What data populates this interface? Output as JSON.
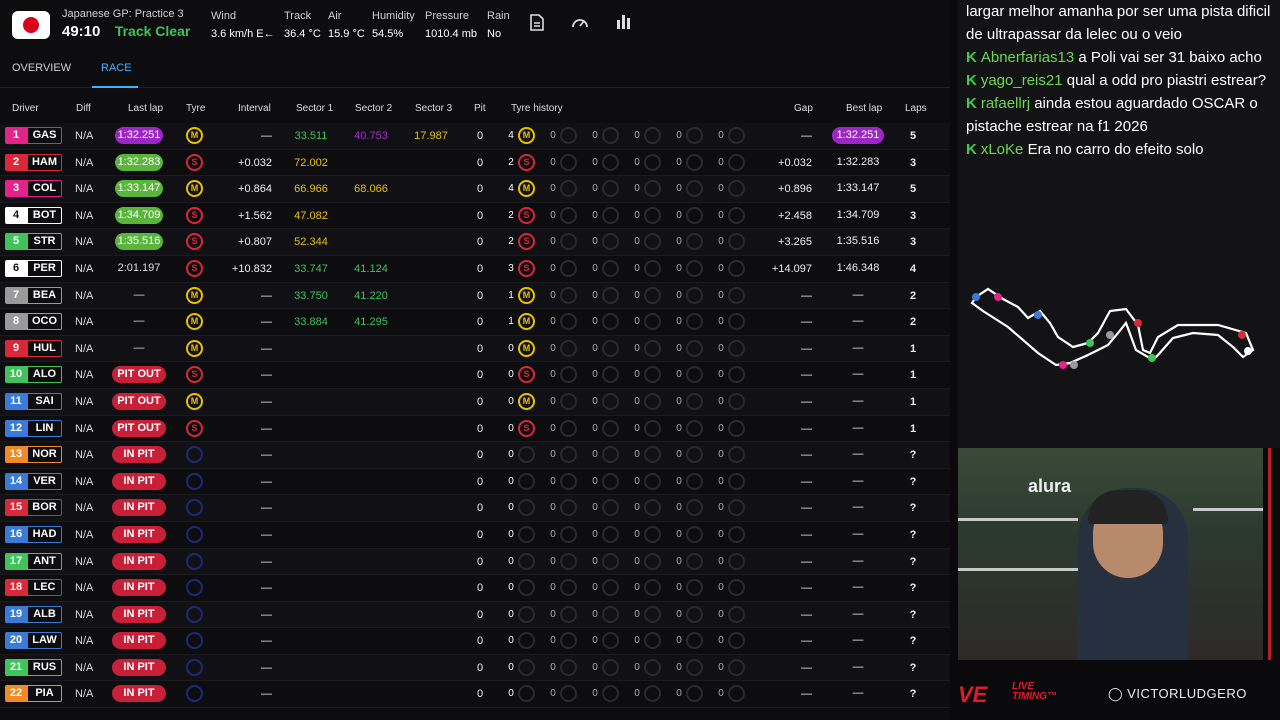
{
  "header": {
    "session_name": "Japanese GP: Practice 3",
    "clock": "49:10",
    "track_status": "Track Clear",
    "weather": [
      {
        "label": "Wind",
        "value": "3.6 km/h E←"
      },
      {
        "label": "Track",
        "value": "36.4 °C"
      },
      {
        "label": "Air",
        "value": "15.9 °C"
      },
      {
        "label": "Humidity",
        "value": "54.5%"
      },
      {
        "label": "Pressure",
        "value": "1010.4 mb"
      },
      {
        "label": "Rain",
        "value": "No"
      }
    ],
    "icons": [
      "document-icon",
      "speedometer-icon",
      "bar-chart-icon"
    ]
  },
  "tabs": [
    {
      "label": "OVERVIEW",
      "active": false
    },
    {
      "label": "RACE",
      "active": true
    }
  ],
  "columns": [
    "Driver",
    "Diff",
    "Last lap",
    "Tyre",
    "Interval",
    "Sector 1",
    "Sector 2",
    "Sector 3",
    "Pit",
    "Tyre history",
    "Gap",
    "Best lap",
    "Laps"
  ],
  "rows": [
    {
      "pos": "1",
      "code": "GAS",
      "team": "#e2238a",
      "diff": "N/A",
      "last": "1:32.251",
      "last_style": "purple",
      "tyre": "M",
      "interval": "—",
      "s1": "33.511",
      "s1c": "g",
      "s2": "40.753",
      "s2c": "p",
      "s3": "17.987",
      "s3c": "y",
      "pit": "0",
      "hist_n": "4",
      "hist_t": "M",
      "gap": "—",
      "best": "1:32.251",
      "best_style": "purple",
      "laps": "5"
    },
    {
      "pos": "2",
      "code": "HAM",
      "team": "#d8283a",
      "diff": "N/A",
      "last": "1:32.283",
      "last_style": "best",
      "tyre": "S",
      "interval": "+0.032",
      "s1": "72.002",
      "s1c": "y",
      "s2": "",
      "s2c": "",
      "s3": "",
      "s3c": "",
      "pit": "0",
      "hist_n": "2",
      "hist_t": "S",
      "gap": "+0.032",
      "best": "1:32.283",
      "best_style": "",
      "laps": "3"
    },
    {
      "pos": "3",
      "code": "COL",
      "team": "#e2238a",
      "diff": "N/A",
      "last": "1:33.147",
      "last_style": "best",
      "tyre": "M",
      "interval": "+0.864",
      "s1": "66.966",
      "s1c": "y",
      "s2": "68.066",
      "s2c": "y",
      "s3": "",
      "s3c": "",
      "pit": "0",
      "hist_n": "4",
      "hist_t": "M",
      "gap": "+0.896",
      "best": "1:33.147",
      "best_style": "",
      "laps": "5"
    },
    {
      "pos": "4",
      "code": "BOT",
      "team": "#ffffff",
      "diff": "N/A",
      "last": "1:34.709",
      "last_style": "best",
      "tyre": "S",
      "interval": "+1.562",
      "s1": "47.082",
      "s1c": "y",
      "s2": "",
      "s2c": "",
      "s3": "",
      "s3c": "",
      "pit": "0",
      "hist_n": "2",
      "hist_t": "S",
      "gap": "+2.458",
      "best": "1:34.709",
      "best_style": "",
      "laps": "3"
    },
    {
      "pos": "5",
      "code": "STR",
      "team": "#3fc35a",
      "diff": "N/A",
      "last": "1:35.516",
      "last_style": "best",
      "tyre": "S",
      "interval": "+0.807",
      "s1": "52.344",
      "s1c": "y",
      "s2": "",
      "s2c": "",
      "s3": "",
      "s3c": "",
      "pit": "0",
      "hist_n": "2",
      "hist_t": "S",
      "gap": "+3.265",
      "best": "1:35.516",
      "best_style": "",
      "laps": "3"
    },
    {
      "pos": "6",
      "code": "PER",
      "team": "#ffffff",
      "diff": "N/A",
      "last": "2:01.197",
      "last_style": "plain",
      "tyre": "S",
      "interval": "+10.832",
      "s1": "33.747",
      "s1c": "g",
      "s2": "41.124",
      "s2c": "g",
      "s3": "",
      "s3c": "",
      "pit": "0",
      "hist_n": "3",
      "hist_t": "S",
      "gap": "+14.097",
      "best": "1:46.348",
      "best_style": "",
      "laps": "4"
    },
    {
      "pos": "7",
      "code": "BEA",
      "team": "#9a9a9a",
      "diff": "N/A",
      "last": "—",
      "last_style": "plain",
      "tyre": "M",
      "interval": "—",
      "s1": "33.750",
      "s1c": "g",
      "s2": "41.220",
      "s2c": "g",
      "s3": "",
      "s3c": "",
      "pit": "0",
      "hist_n": "1",
      "hist_t": "M",
      "gap": "—",
      "best": "—",
      "best_style": "",
      "laps": "2"
    },
    {
      "pos": "8",
      "code": "OCO",
      "team": "#9a9a9a",
      "diff": "N/A",
      "last": "—",
      "last_style": "plain",
      "tyre": "M",
      "interval": "—",
      "s1": "33.884",
      "s1c": "g",
      "s2": "41.295",
      "s2c": "g",
      "s3": "",
      "s3c": "",
      "pit": "0",
      "hist_n": "1",
      "hist_t": "M",
      "gap": "—",
      "best": "—",
      "best_style": "",
      "laps": "2"
    },
    {
      "pos": "9",
      "code": "HUL",
      "team": "#d8283a",
      "diff": "N/A",
      "last": "—",
      "last_style": "plain",
      "tyre": "M",
      "interval": "—",
      "s1": "",
      "s1c": "",
      "s2": "",
      "s2c": "",
      "s3": "",
      "s3c": "",
      "pit": "0",
      "hist_n": "0",
      "hist_t": "M",
      "gap": "—",
      "best": "—",
      "best_style": "",
      "laps": "1"
    },
    {
      "pos": "10",
      "code": "ALO",
      "team": "#3fc35a",
      "diff": "N/A",
      "last": "PIT OUT",
      "last_style": "red",
      "tyre": "S",
      "interval": "—",
      "s1": "",
      "s1c": "",
      "s2": "",
      "s2c": "",
      "s3": "",
      "s3c": "",
      "pit": "0",
      "hist_n": "0",
      "hist_t": "S",
      "gap": "—",
      "best": "—",
      "best_style": "",
      "laps": "1"
    },
    {
      "pos": "11",
      "code": "SAI",
      "team": "#3a7bd8",
      "diff": "N/A",
      "last": "PIT OUT",
      "last_style": "red",
      "tyre": "M",
      "interval": "—",
      "s1": "",
      "s1c": "",
      "s2": "",
      "s2c": "",
      "s3": "",
      "s3c": "",
      "pit": "0",
      "hist_n": "0",
      "hist_t": "M",
      "gap": "—",
      "best": "—",
      "best_style": "",
      "laps": "1"
    },
    {
      "pos": "12",
      "code": "LIN",
      "team": "#3a7bd8",
      "diff": "N/A",
      "last": "PIT OUT",
      "last_style": "red",
      "tyre": "S",
      "interval": "—",
      "s1": "",
      "s1c": "",
      "s2": "",
      "s2c": "",
      "s3": "",
      "s3c": "",
      "pit": "0",
      "hist_n": "0",
      "hist_t": "S",
      "gap": "—",
      "best": "—",
      "best_style": "",
      "laps": "1"
    },
    {
      "pos": "13",
      "code": "NOR",
      "team": "#f08a24",
      "diff": "N/A",
      "last": "IN PIT",
      "last_style": "red",
      "tyre": "N",
      "interval": "—",
      "s1": "",
      "s1c": "",
      "s2": "",
      "s2c": "",
      "s3": "",
      "s3c": "",
      "pit": "0",
      "hist_n": "0",
      "hist_t": "",
      "gap": "—",
      "best": "—",
      "best_style": "",
      "laps": "?"
    },
    {
      "pos": "14",
      "code": "VER",
      "team": "#3a7bd8",
      "diff": "N/A",
      "last": "IN PIT",
      "last_style": "red",
      "tyre": "N",
      "interval": "—",
      "s1": "",
      "s1c": "",
      "s2": "",
      "s2c": "",
      "s3": "",
      "s3c": "",
      "pit": "0",
      "hist_n": "0",
      "hist_t": "",
      "gap": "—",
      "best": "—",
      "best_style": "",
      "laps": "?"
    },
    {
      "pos": "15",
      "code": "BOR",
      "team": "#d8283a",
      "diff": "N/A",
      "last": "IN PIT",
      "last_style": "red",
      "tyre": "N",
      "interval": "—",
      "s1": "",
      "s1c": "",
      "s2": "",
      "s2c": "",
      "s3": "",
      "s3c": "",
      "pit": "0",
      "hist_n": "0",
      "hist_t": "",
      "gap": "—",
      "best": "—",
      "best_style": "",
      "laps": "?"
    },
    {
      "pos": "16",
      "code": "HAD",
      "team": "#3a7bd8",
      "diff": "N/A",
      "last": "IN PIT",
      "last_style": "red",
      "tyre": "N",
      "interval": "—",
      "s1": "",
      "s1c": "",
      "s2": "",
      "s2c": "",
      "s3": "",
      "s3c": "",
      "pit": "0",
      "hist_n": "0",
      "hist_t": "",
      "gap": "—",
      "best": "—",
      "best_style": "",
      "laps": "?"
    },
    {
      "pos": "17",
      "code": "ANT",
      "team": "#3fc35a",
      "diff": "N/A",
      "last": "IN PIT",
      "last_style": "red",
      "tyre": "N",
      "interval": "—",
      "s1": "",
      "s1c": "",
      "s2": "",
      "s2c": "",
      "s3": "",
      "s3c": "",
      "pit": "0",
      "hist_n": "0",
      "hist_t": "",
      "gap": "—",
      "best": "—",
      "best_style": "",
      "laps": "?"
    },
    {
      "pos": "18",
      "code": "LEC",
      "team": "#d8283a",
      "diff": "N/A",
      "last": "IN PIT",
      "last_style": "red",
      "tyre": "N",
      "interval": "—",
      "s1": "",
      "s1c": "",
      "s2": "",
      "s2c": "",
      "s3": "",
      "s3c": "",
      "pit": "0",
      "hist_n": "0",
      "hist_t": "",
      "gap": "—",
      "best": "—",
      "best_style": "",
      "laps": "?"
    },
    {
      "pos": "19",
      "code": "ALB",
      "team": "#3a7bd8",
      "diff": "N/A",
      "last": "IN PIT",
      "last_style": "red",
      "tyre": "N",
      "interval": "—",
      "s1": "",
      "s1c": "",
      "s2": "",
      "s2c": "",
      "s3": "",
      "s3c": "",
      "pit": "0",
      "hist_n": "0",
      "hist_t": "",
      "gap": "—",
      "best": "—",
      "best_style": "",
      "laps": "?"
    },
    {
      "pos": "20",
      "code": "LAW",
      "team": "#3a7bd8",
      "diff": "N/A",
      "last": "IN PIT",
      "last_style": "red",
      "tyre": "N",
      "interval": "—",
      "s1": "",
      "s1c": "",
      "s2": "",
      "s2c": "",
      "s3": "",
      "s3c": "",
      "pit": "0",
      "hist_n": "0",
      "hist_t": "",
      "gap": "—",
      "best": "—",
      "best_style": "",
      "laps": "?"
    },
    {
      "pos": "21",
      "code": "RUS",
      "team": "#3fc35a",
      "diff": "N/A",
      "last": "IN PIT",
      "last_style": "red",
      "tyre": "N",
      "interval": "—",
      "s1": "",
      "s1c": "",
      "s2": "",
      "s2c": "",
      "s3": "",
      "s3c": "",
      "pit": "0",
      "hist_n": "0",
      "hist_t": "",
      "gap": "—",
      "best": "—",
      "best_style": "",
      "laps": "?"
    },
    {
      "pos": "22",
      "code": "PIA",
      "team": "#f08a24",
      "diff": "N/A",
      "last": "IN PIT",
      "last_style": "red",
      "tyre": "N",
      "interval": "—",
      "s1": "",
      "s1c": "",
      "s2": "",
      "s2c": "",
      "s3": "",
      "s3c": "",
      "pit": "0",
      "hist_n": "0",
      "hist_t": "",
      "gap": "—",
      "best": "—",
      "best_style": "",
      "laps": "?"
    }
  ],
  "history_zeros": [
    "0",
    "0",
    "0",
    "0",
    "0"
  ],
  "chat": [
    {
      "user": "",
      "text": "largar melhor amanha por ser uma pista dificil de ultrapassar da lelec ou o veio"
    },
    {
      "user": "Abnerfarias13",
      "text": "a Poli vai ser 31 baixo acho"
    },
    {
      "user": "yago_reis21",
      "text": "qual a odd pro piastri estrear?"
    },
    {
      "user": "rafaellrj",
      "text": "ainda estou aguardado OSCAR o pistache estrear na f1 2026"
    },
    {
      "user": "xLoKe",
      "text": "Era no carro do efeito solo"
    }
  ],
  "chat_badge": "K",
  "camera": {
    "sign": "alura"
  },
  "brand": {
    "logo": "VE",
    "tag1": "LIVE",
    "tag2": "TIMING™",
    "instagram": "VICTORLUDGERO"
  },
  "colors": {
    "accent": "#3fb4ff",
    "track_clear": "#3fc35a",
    "purple": "#9b27c4",
    "green": "#5ab53d",
    "red": "#c9203a"
  }
}
